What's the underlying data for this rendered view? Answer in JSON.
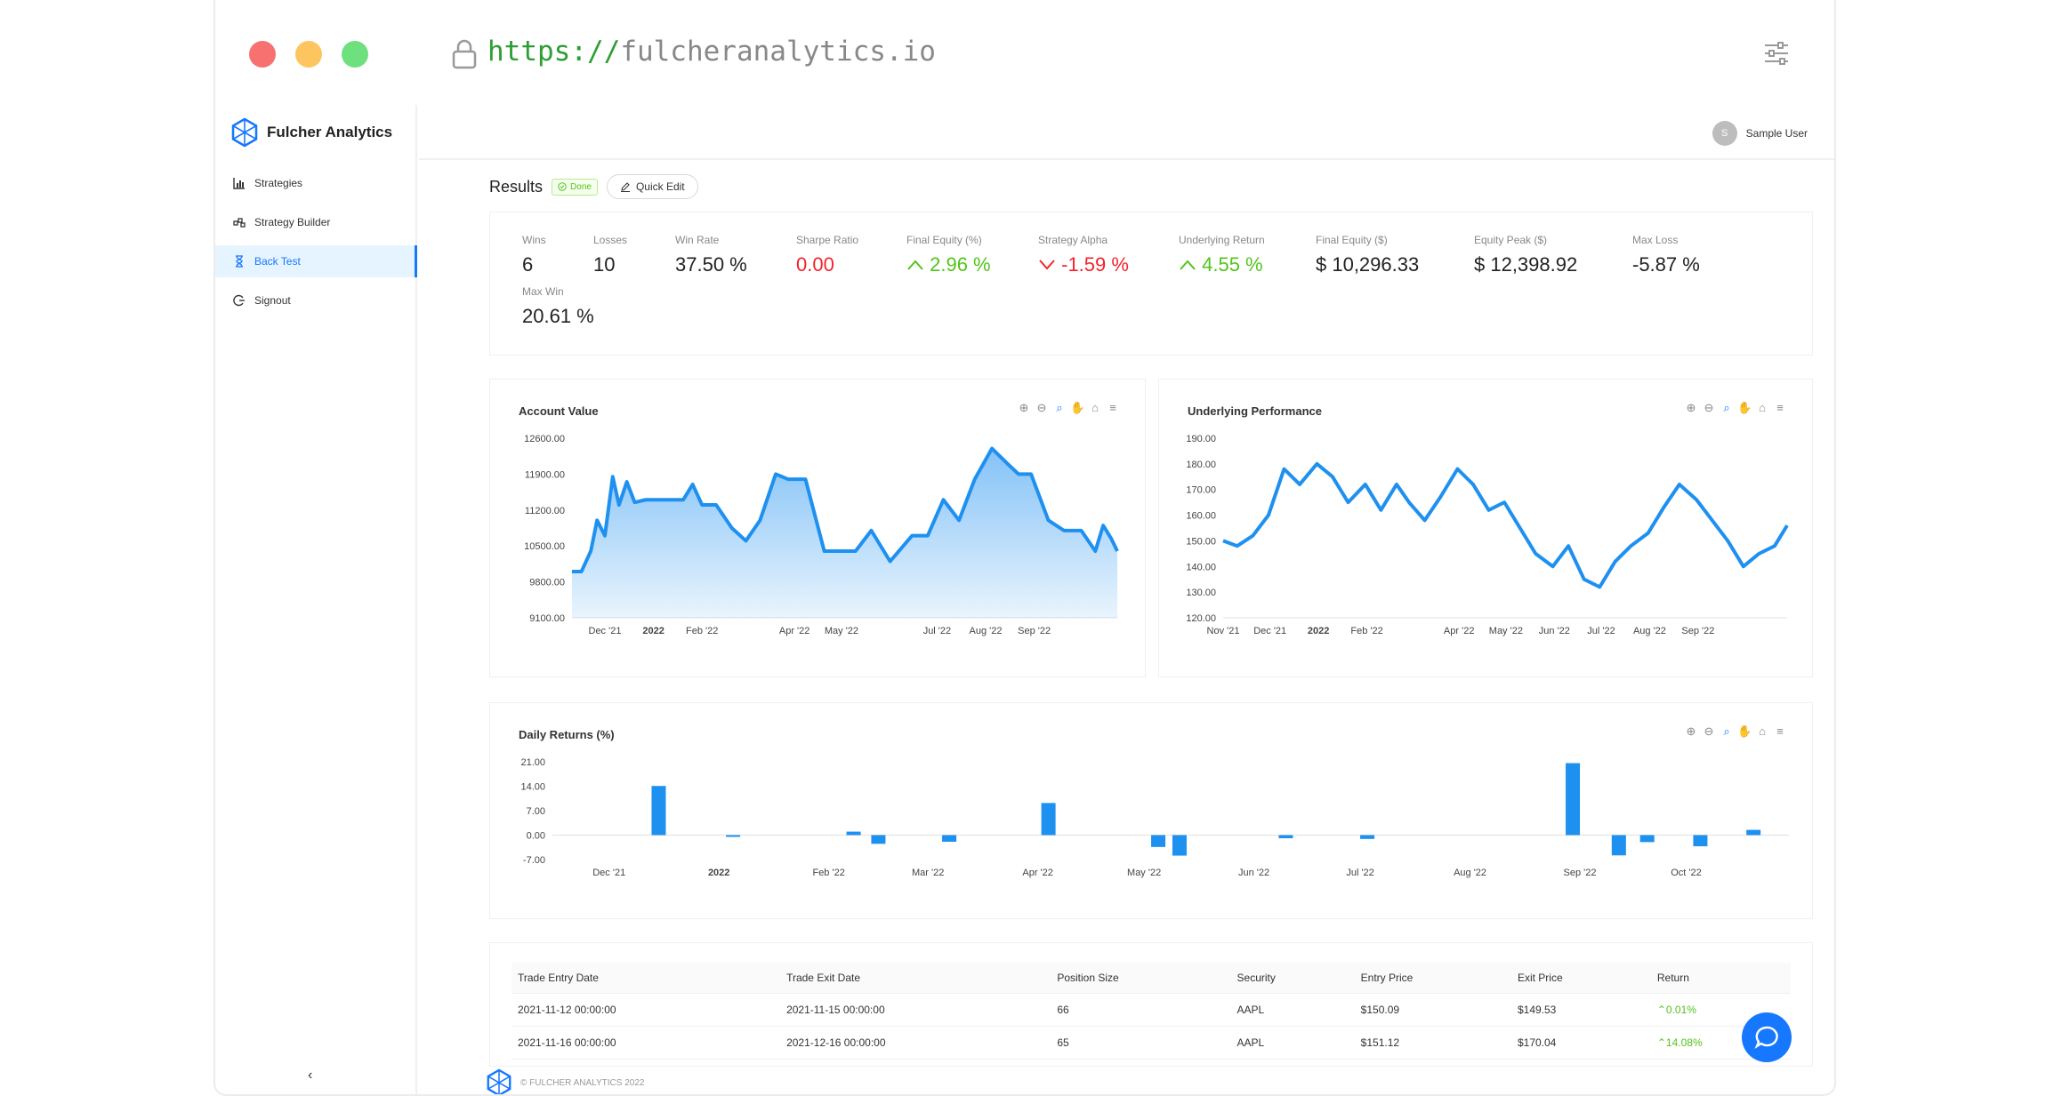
{
  "browser": {
    "scheme": "https://",
    "host": "fulcheranalytics.io"
  },
  "app": {
    "brand": "Fulcher Analytics",
    "user_initial": "S",
    "user_name": "Sample User"
  },
  "sidebar": {
    "items": [
      {
        "label": "Strategies",
        "icon": "bar-chart-icon"
      },
      {
        "label": "Strategy Builder",
        "icon": "builder-icon"
      },
      {
        "label": "Back Test",
        "icon": "hourglass-icon",
        "active": true
      },
      {
        "label": "Signout",
        "icon": "logout-icon"
      }
    ],
    "collapse": "‹"
  },
  "results": {
    "title": "Results",
    "status": "Done",
    "quick_edit": "Quick Edit"
  },
  "stats": [
    {
      "label": "Wins",
      "value": "6"
    },
    {
      "label": "Losses",
      "value": "10"
    },
    {
      "label": "Win Rate",
      "value": "37.50 %"
    },
    {
      "label": "Sharpe Ratio",
      "value": "0.00"
    },
    {
      "label": "Final Equity (%)",
      "value": "2.96 %"
    },
    {
      "label": "Strategy Alpha",
      "value": "-1.59 %"
    },
    {
      "label": "Underlying Return",
      "value": "4.55 %"
    },
    {
      "label": "Final Equity ($)",
      "value": "$ 10,296.33"
    },
    {
      "label": "Equity Peak ($)",
      "value": "$ 12,398.92"
    },
    {
      "label": "Max Loss",
      "value": "-5.87 %"
    },
    {
      "label": "Max Win",
      "value": "20.61 %"
    }
  ],
  "colors": {
    "accent": "#1677ff",
    "series": "#1e90f0",
    "positive": "#52c41a",
    "negative": "#f5222d"
  },
  "chart_data": [
    {
      "type": "area",
      "title": "Account Value",
      "x_ticks": [
        "Dec '21",
        "2022",
        "Feb '22",
        "Apr '22",
        "May '22",
        "Jul '22",
        "Aug '22",
        "Sep '22"
      ],
      "y_ticks": [
        "12600.00",
        "11900.00",
        "11200.00",
        "10500.00",
        "9800.00",
        "9100.00"
      ],
      "ylim": [
        9100,
        12600
      ],
      "x": [
        "2021-11-10",
        "2021-11-16",
        "2021-11-22",
        "2021-11-26",
        "2021-12-01",
        "2021-12-06",
        "2021-12-10",
        "2021-12-15",
        "2021-12-20",
        "2021-12-27",
        "2022-01-10",
        "2022-01-20",
        "2022-01-26",
        "2022-02-01",
        "2022-02-10",
        "2022-02-20",
        "2022-03-01",
        "2022-03-10",
        "2022-03-20",
        "2022-03-28",
        "2022-04-04",
        "2022-04-08",
        "2022-04-20",
        "2022-05-01",
        "2022-05-10",
        "2022-05-20",
        "2022-06-01",
        "2022-06-15",
        "2022-06-25",
        "2022-07-05",
        "2022-07-15",
        "2022-07-25",
        "2022-08-05",
        "2022-08-15",
        "2022-08-22",
        "2022-08-30",
        "2022-09-10",
        "2022-09-20",
        "2022-10-01",
        "2022-10-10",
        "2022-10-15",
        "2022-10-20",
        "2022-10-24"
      ],
      "values": [
        10000,
        10000,
        10400,
        11000,
        10700,
        11850,
        11300,
        11750,
        11350,
        11400,
        11400,
        11400,
        11700,
        11300,
        11300,
        10850,
        10600,
        11000,
        11900,
        11800,
        11800,
        11800,
        10400,
        10400,
        10400,
        10800,
        10200,
        10700,
        10700,
        11400,
        11000,
        11800,
        12400,
        12100,
        11900,
        11900,
        11000,
        10800,
        10800,
        10400,
        10900,
        10650,
        10400
      ],
      "color": "#1e90f0"
    },
    {
      "type": "line",
      "title": "Underlying Performance",
      "x_ticks": [
        "Nov '21",
        "Dec '21",
        "2022",
        "Feb '22",
        "Apr '22",
        "May '22",
        "Jun '22",
        "Jul '22",
        "Aug '22",
        "Sep '22"
      ],
      "y_ticks": [
        "190.00",
        "180.00",
        "170.00",
        "160.00",
        "150.00",
        "140.00",
        "130.00",
        "120.00"
      ],
      "ylim": [
        120,
        190
      ],
      "x": [
        "2021-11-01",
        "2021-11-10",
        "2021-11-20",
        "2021-11-30",
        "2021-12-10",
        "2021-12-20",
        "2021-12-31",
        "2022-01-10",
        "2022-01-20",
        "2022-01-31",
        "2022-02-10",
        "2022-02-20",
        "2022-02-28",
        "2022-03-10",
        "2022-03-20",
        "2022-03-31",
        "2022-04-10",
        "2022-04-20",
        "2022-04-30",
        "2022-05-10",
        "2022-05-20",
        "2022-05-31",
        "2022-06-10",
        "2022-06-20",
        "2022-06-30",
        "2022-07-10",
        "2022-07-20",
        "2022-07-31",
        "2022-08-10",
        "2022-08-20",
        "2022-08-31",
        "2022-09-10",
        "2022-09-20",
        "2022-09-30",
        "2022-10-10",
        "2022-10-20",
        "2022-10-28"
      ],
      "values": [
        150,
        148,
        152,
        160,
        178,
        172,
        180,
        175,
        165,
        172,
        162,
        172,
        165,
        158,
        167,
        178,
        172,
        162,
        165,
        155,
        145,
        140,
        148,
        135,
        132,
        142,
        148,
        153,
        163,
        172,
        166,
        158,
        150,
        140,
        145,
        148,
        156
      ],
      "color": "#1e90f0"
    },
    {
      "type": "bar",
      "title": "Daily Returns (%)",
      "x_ticks": [
        "Dec '21",
        "2022",
        "Feb '22",
        "Mar '22",
        "Apr '22",
        "May '22",
        "Jun '22",
        "Jul '22",
        "Aug '22",
        "Sep '22",
        "Oct '22"
      ],
      "y_ticks": [
        "21.00",
        "14.00",
        "7.00",
        "0.00",
        "-7.00"
      ],
      "ylim": [
        -7,
        21
      ],
      "x": [
        "2021-12-15",
        "2022-01-05",
        "2022-02-08",
        "2022-02-15",
        "2022-03-07",
        "2022-04-04",
        "2022-05-05",
        "2022-05-11",
        "2022-06-10",
        "2022-07-03",
        "2022-08-30",
        "2022-09-12",
        "2022-09-20",
        "2022-10-05",
        "2022-10-20"
      ],
      "values": [
        14.08,
        -0.35,
        1.0,
        -2.5,
        -1.9,
        9.2,
        -3.4,
        -5.87,
        -0.9,
        -1.1,
        20.61,
        -5.8,
        -2.0,
        -3.2,
        1.5
      ],
      "color": "#1e90f0"
    }
  ],
  "table": {
    "headers": [
      "Trade Entry Date",
      "Trade Exit Date",
      "Position Size",
      "Security",
      "Entry Price",
      "Exit Price",
      "Return"
    ],
    "rows": [
      [
        "2021-11-12 00:00:00",
        "2021-11-15 00:00:00",
        "66",
        "AAPL",
        "$150.09",
        "$149.53",
        "0.01%"
      ],
      [
        "2021-11-16 00:00:00",
        "2021-12-16 00:00:00",
        "65",
        "AAPL",
        "$151.12",
        "$170.04",
        "14.08%"
      ]
    ]
  },
  "footer": {
    "text": "© FULCHER ANALYTICS 2022"
  }
}
